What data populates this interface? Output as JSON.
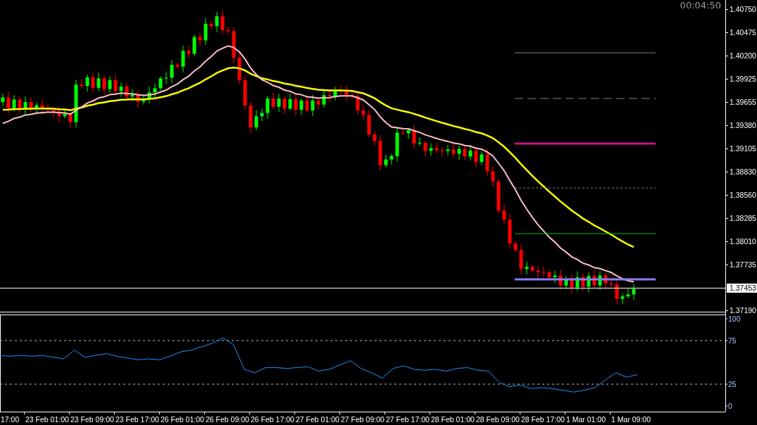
{
  "timer": "00:04:50",
  "price_axis": {
    "labels": [
      "1.40750",
      "1.40475",
      "1.40200",
      "1.39925",
      "1.39655",
      "1.39380",
      "1.39105",
      "1.38830",
      "1.38560",
      "1.38285",
      "1.38010",
      "1.37735",
      "1.37190"
    ],
    "current_price": "1.37453"
  },
  "rsi_panel": {
    "chart_data": {
      "type": "line",
      "ylim": [
        -6.45,
        104.84
      ],
      "yticks": [
        0,
        25,
        75,
        100
      ],
      "values": [
        58,
        57,
        58,
        57,
        58,
        56,
        54,
        64,
        56,
        58,
        60,
        57,
        55,
        53,
        54,
        53,
        57,
        62,
        64,
        68,
        72,
        78,
        70,
        42,
        38,
        44,
        44,
        43,
        44,
        45,
        40,
        42,
        47,
        52,
        43,
        38,
        32,
        43,
        46,
        42,
        41,
        42,
        40,
        43,
        44,
        41,
        40,
        27,
        22,
        24,
        20,
        21,
        20,
        18,
        16,
        18,
        21,
        30,
        38,
        33,
        36
      ]
    }
  },
  "time_axis": {
    "labels": [
      "17:00",
      "23 Feb 01:00",
      "23 Feb 09:00",
      "23 Feb 17:00",
      "26 Feb 01:00",
      "26 Feb 09:00",
      "26 Feb 17:00",
      "27 Feb 01:00",
      "27 Feb 09:00",
      "27 Feb 17:00",
      "28 Feb 01:00",
      "28 Feb 09:00",
      "28 Feb 17:00",
      "1 Mar 01:00",
      "1 Mar 09:00"
    ]
  }
}
